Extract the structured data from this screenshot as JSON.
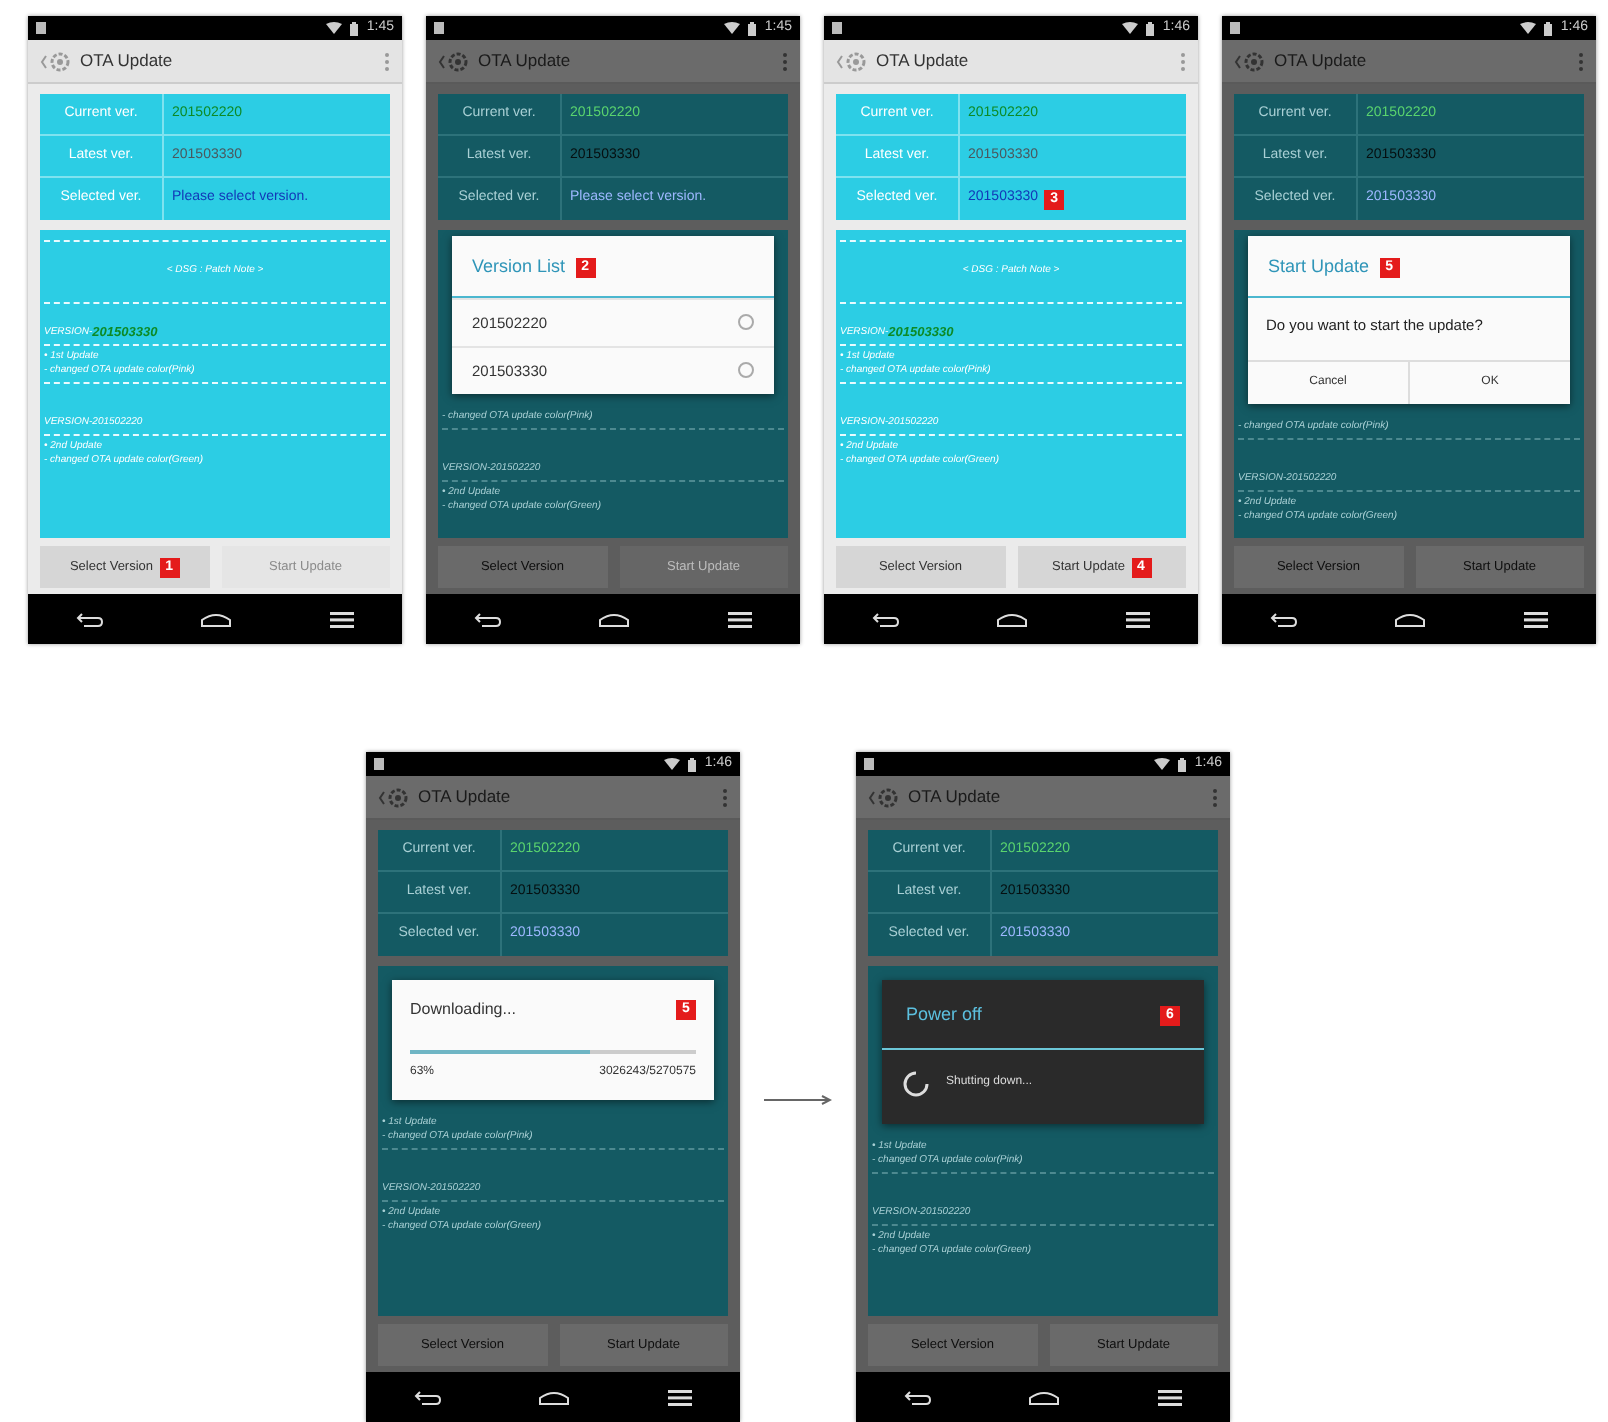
{
  "screens": [
    {
      "status_bar": {
        "time": "1:45"
      },
      "app_bar": {
        "title": "OTA Update"
      },
      "dimmed": false,
      "info": [
        {
          "label": "Current ver.",
          "value": "201502220",
          "color": "#0d8a26"
        },
        {
          "label": "Latest ver.",
          "value": "201503330",
          "color": "#4a585e"
        },
        {
          "label": "Selected ver.",
          "value": "Please select version.",
          "color": "#1238b8"
        }
      ],
      "notes": [
        {
          "kind": "heading",
          "text": "< DSG : Patch Note >"
        },
        {
          "kind": "version",
          "text": "VERSION-",
          "value": "201503330",
          "color": "#0d8a26"
        },
        {
          "kind": "bullet",
          "text": "• 1st Update"
        },
        {
          "kind": "detail",
          "text": "- changed OTA update color(Pink)"
        },
        {
          "kind": "version",
          "text": "VERSION-201502220"
        },
        {
          "kind": "bullet",
          "text": "• 2nd Update"
        },
        {
          "kind": "detail",
          "text": "- changed OTA update color(Green)"
        }
      ],
      "buttons": [
        {
          "label": "Select Version",
          "disabled": false,
          "marker": "1"
        },
        {
          "label": "Start Update",
          "disabled": true
        }
      ]
    },
    {
      "status_bar": {
        "time": "1:45"
      },
      "app_bar": {
        "title": "OTA Update"
      },
      "dimmed": true,
      "info": [
        {
          "label": "Current ver.",
          "value": "201502220",
          "color": "#5ad46e"
        },
        {
          "label": "Latest ver.",
          "value": "201503330",
          "color": "#050f10"
        },
        {
          "label": "Selected ver.",
          "value": "Please select version.",
          "color": "#9db8ff"
        }
      ],
      "dialog": {
        "kind": "list",
        "title": "Version List",
        "marker": "2",
        "options": [
          {
            "label": "201502220",
            "selected": false
          },
          {
            "label": "201503330",
            "selected": false
          }
        ]
      },
      "notes": [
        {
          "kind": "detail",
          "text": "- changed OTA update color(Pink)"
        },
        {
          "kind": "version",
          "text": "VERSION-201502220"
        },
        {
          "kind": "bullet",
          "text": "• 2nd Update"
        },
        {
          "kind": "detail",
          "text": "- changed OTA update color(Green)"
        }
      ],
      "buttons": [
        {
          "label": "Select Version",
          "disabled": false
        },
        {
          "label": "Start Update",
          "disabled": true
        }
      ]
    },
    {
      "status_bar": {
        "time": "1:46"
      },
      "app_bar": {
        "title": "OTA Update"
      },
      "dimmed": false,
      "info": [
        {
          "label": "Current ver.",
          "value": "201502220",
          "color": "#0d8a26"
        },
        {
          "label": "Latest ver.",
          "value": "201503330",
          "color": "#4a585e"
        },
        {
          "label": "Selected ver.",
          "value": "201503330",
          "color": "#1238b8",
          "marker": "3"
        }
      ],
      "notes": [
        {
          "kind": "heading",
          "text": "< DSG : Patch Note >"
        },
        {
          "kind": "version",
          "text": "VERSION-",
          "value": "201503330",
          "color": "#0d8a26"
        },
        {
          "kind": "bullet",
          "text": "• 1st Update"
        },
        {
          "kind": "detail",
          "text": "- changed OTA update color(Pink)"
        },
        {
          "kind": "version",
          "text": "VERSION-201502220"
        },
        {
          "kind": "bullet",
          "text": "• 2nd Update"
        },
        {
          "kind": "detail",
          "text": "- changed OTA update color(Green)"
        }
      ],
      "buttons": [
        {
          "label": "Select Version",
          "disabled": false
        },
        {
          "label": "Start Update",
          "disabled": false,
          "marker": "4"
        }
      ]
    },
    {
      "status_bar": {
        "time": "1:46"
      },
      "app_bar": {
        "title": "OTA Update"
      },
      "dimmed": true,
      "info": [
        {
          "label": "Current ver.",
          "value": "201502220",
          "color": "#5ad46e"
        },
        {
          "label": "Latest ver.",
          "value": "201503330",
          "color": "#050f10"
        },
        {
          "label": "Selected ver.",
          "value": "201503330",
          "color": "#9db8ff"
        }
      ],
      "dialog": {
        "kind": "confirm",
        "title": "Start Update",
        "marker": "5",
        "message": "Do you want to start the update?",
        "buttons": [
          "Cancel",
          "OK"
        ]
      },
      "notes": [
        {
          "kind": "detail",
          "text": "- changed OTA update color(Pink)"
        },
        {
          "kind": "version",
          "text": "VERSION-201502220"
        },
        {
          "kind": "bullet",
          "text": "• 2nd Update"
        },
        {
          "kind": "detail",
          "text": "- changed OTA update color(Green)"
        }
      ],
      "buttons": [
        {
          "label": "Select Version",
          "disabled": false
        },
        {
          "label": "Start Update",
          "disabled": false
        }
      ]
    },
    {
      "status_bar": {
        "time": "1:46"
      },
      "app_bar": {
        "title": "OTA Update"
      },
      "dimmed": true,
      "info": [
        {
          "label": "Current ver.",
          "value": "201502220",
          "color": "#5ad46e"
        },
        {
          "label": "Latest ver.",
          "value": "201503330",
          "color": "#050f10"
        },
        {
          "label": "Selected ver.",
          "value": "201503330",
          "color": "#9db8ff"
        }
      ],
      "dialog": {
        "kind": "progress",
        "title": "Downloading...",
        "marker": "5",
        "level": 0.63,
        "percent": "63%",
        "count": "3026243/5270575"
      },
      "notes": [
        {
          "kind": "bullet",
          "text": "• 1st Update"
        },
        {
          "kind": "detail",
          "text": "- changed OTA update color(Pink)"
        },
        {
          "kind": "version",
          "text": "VERSION-201502220"
        },
        {
          "kind": "bullet",
          "text": "• 2nd Update"
        },
        {
          "kind": "detail",
          "text": "- changed OTA update color(Green)"
        }
      ],
      "buttons": [
        {
          "label": "Select Version",
          "disabled": false
        },
        {
          "label": "Start Update",
          "disabled": false
        }
      ]
    },
    {
      "status_bar": {
        "time": "1:46"
      },
      "app_bar": {
        "title": "OTA Update"
      },
      "dimmed": true,
      "info": [
        {
          "label": "Current ver.",
          "value": "201502220",
          "color": "#5ad46e"
        },
        {
          "label": "Latest ver.",
          "value": "201503330",
          "color": "#050f10"
        },
        {
          "label": "Selected ver.",
          "value": "201503330",
          "color": "#9db8ff"
        }
      ],
      "dialog": {
        "kind": "spinner",
        "title": "Power off",
        "marker": "6",
        "message": "Shutting down..."
      },
      "notes": [
        {
          "kind": "bullet",
          "text": "• 1st Update"
        },
        {
          "kind": "detail",
          "text": "- changed OTA update color(Pink)"
        },
        {
          "kind": "version",
          "text": "VERSION-201502220"
        },
        {
          "kind": "bullet",
          "text": "• 2nd Update"
        },
        {
          "kind": "detail",
          "text": "- changed OTA update color(Green)"
        }
      ],
      "buttons": [
        {
          "label": "Select Version",
          "disabled": false
        },
        {
          "label": "Start Update",
          "disabled": false
        }
      ]
    }
  ]
}
